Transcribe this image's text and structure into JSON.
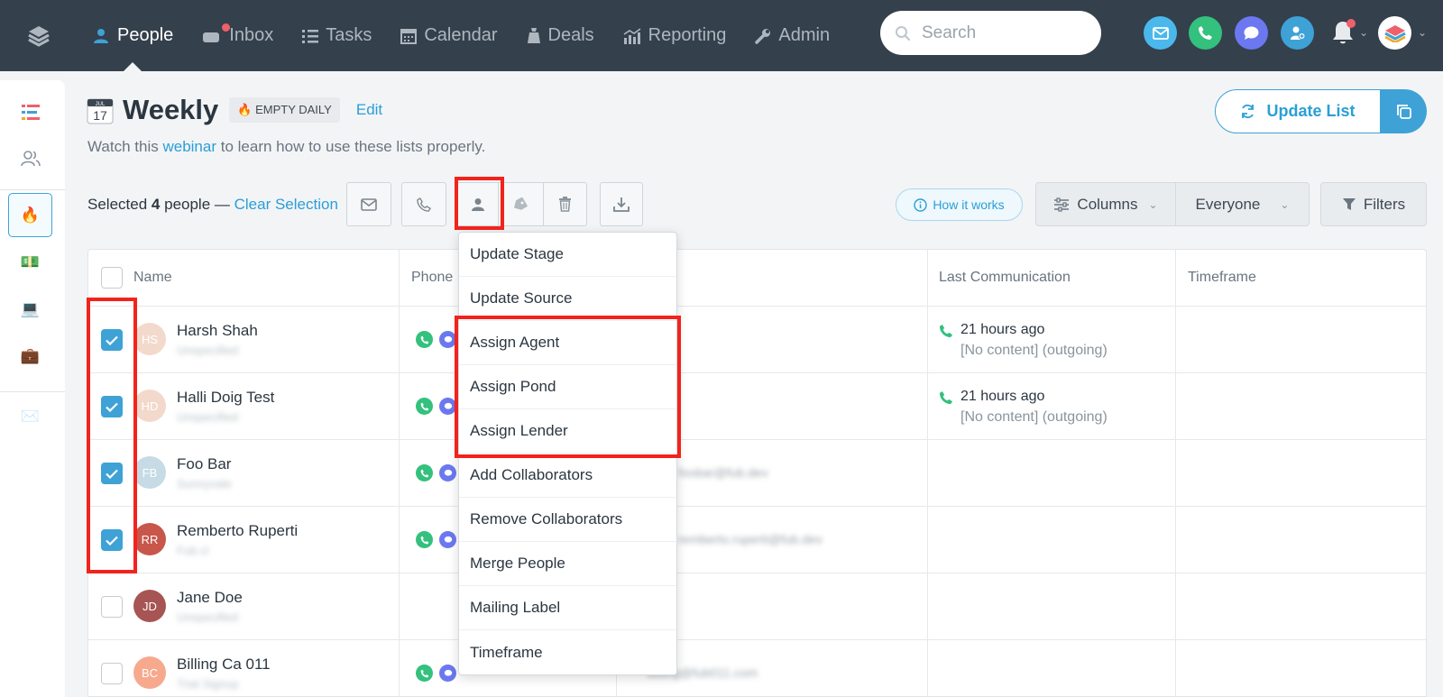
{
  "nav": {
    "items": [
      {
        "label": "People",
        "icon": "person-icon",
        "active": true
      },
      {
        "label": "Inbox",
        "icon": "inbox-icon"
      },
      {
        "label": "Tasks",
        "icon": "list-icon"
      },
      {
        "label": "Calendar",
        "icon": "calendar-icon"
      },
      {
        "label": "Deals",
        "icon": "bag-icon"
      },
      {
        "label": "Reporting",
        "icon": "chart-icon"
      },
      {
        "label": "Admin",
        "icon": "wrench-icon"
      }
    ],
    "search_placeholder": "Search"
  },
  "page": {
    "calendar_day": "17",
    "calendar_month": "JUL",
    "title": "Weekly",
    "badge": "🔥 EMPTY DAILY",
    "edit": "Edit",
    "subtitle_before": "Watch this",
    "subtitle_link": "webinar",
    "subtitle_after": "to learn how to use these lists properly."
  },
  "toolbar": {
    "update_list": "Update List",
    "selected_prefix": "Selected",
    "selected_count": "4",
    "selected_suffix": "people —",
    "clear_selection": "Clear Selection",
    "how_it_works": "How it works",
    "columns": "Columns",
    "everyone": "Everyone",
    "filters": "Filters"
  },
  "table": {
    "headers": {
      "name": "Name",
      "phone": "Phone",
      "last_comm": "Last Communication",
      "timeframe": "Timeframe"
    },
    "rows": [
      {
        "initials": "HS",
        "name": "Harsh Shah",
        "sub": "Unspecified",
        "email": "",
        "last": "21 hours ago",
        "last_sub": "[No content] (outgoing)",
        "checked": true,
        "avatar_color": "#f3d9cc"
      },
      {
        "initials": "HD",
        "name": "Halli Doig Test",
        "sub": "Unspecified",
        "email": "",
        "last": "21 hours ago",
        "last_sub": "[No content] (outgoing)",
        "checked": true,
        "avatar_color": "#f3d9cc"
      },
      {
        "initials": "FB",
        "name": "Foo Bar",
        "sub": "Sunnyvale",
        "email": "foobar@fub.dev",
        "last": "",
        "last_sub": "",
        "checked": true,
        "avatar_color": "#c6dbe5"
      },
      {
        "initials": "RR",
        "name": "Remberto Ruperti",
        "sub": "Fub.cl",
        "email": "remberto.ruperti@fub.dev",
        "last": "",
        "last_sub": "",
        "checked": true,
        "avatar_color": "#c8564a"
      },
      {
        "initials": "JD",
        "name": "Jane Doe",
        "sub": "Unspecified",
        "email": "",
        "last": "",
        "last_sub": "",
        "checked": false,
        "avatar_color": "#a75454"
      },
      {
        "initials": "BC",
        "name": "Billing Ca 011",
        "sub": "Trial Signup",
        "email": "billing@fub011.com",
        "last": "",
        "last_sub": "",
        "checked": false,
        "avatar_color": "#f7a98e"
      }
    ]
  },
  "menu": {
    "items": [
      "Update Stage",
      "Update Source",
      "Assign Agent",
      "Assign Pond",
      "Assign Lender",
      "Add Collaborators",
      "Remove Collaborators",
      "Merge People",
      "Mailing Label",
      "Timeframe"
    ]
  }
}
